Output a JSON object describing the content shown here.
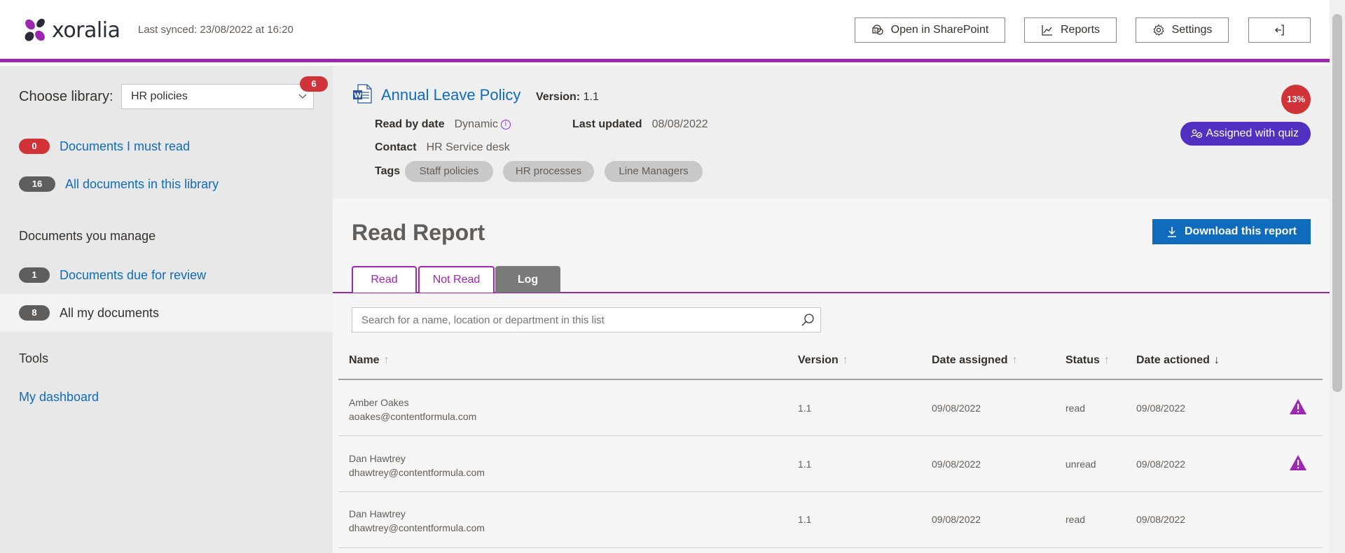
{
  "header": {
    "logo_text": "xoralia",
    "synced": "Last synced: 23/08/2022 at 16:20",
    "buttons": {
      "sharepoint": "Open in SharePoint",
      "reports": "Reports",
      "settings": "Settings"
    },
    "accent_color": "#9c27b0"
  },
  "sidebar": {
    "choose_label": "Choose library:",
    "library_value": "HR policies",
    "library_count": "6",
    "nav": [
      {
        "count": "0",
        "label": "Documents I must read"
      },
      {
        "count": "16",
        "label": "All documents in this library"
      }
    ],
    "manage_title": "Documents you manage",
    "manage": [
      {
        "count": "1",
        "label": "Documents due for review"
      },
      {
        "count": "8",
        "label": "All my documents"
      }
    ],
    "tools_title": "Tools",
    "tools_link": "My dashboard"
  },
  "document": {
    "title": "Annual Leave Policy",
    "version_label": "Version:",
    "version_value": "1.1",
    "read_by_label": "Read by date",
    "read_by_value": "Dynamic",
    "last_updated_label": "Last updated",
    "last_updated_value": "08/08/2022",
    "contact_label": "Contact",
    "contact_value": "HR Service desk",
    "tags_label": "Tags",
    "tags": [
      "Staff policies",
      "HR processes",
      "Line Managers"
    ],
    "percent": "13%",
    "quiz_badge": "Assigned with quiz"
  },
  "report": {
    "title": "Read Report",
    "download": "Download this report",
    "tabs": [
      "Read",
      "Not Read",
      "Log"
    ],
    "search_placeholder": "Search for a name, location or department in this list",
    "columns": [
      "Name",
      "Version",
      "Date assigned",
      "Status",
      "Date actioned"
    ],
    "rows": [
      {
        "name": "Amber Oakes",
        "email": "aoakes@contentformula.com",
        "version": "1.1",
        "assigned": "09/08/2022",
        "status": "read",
        "actioned": "09/08/2022",
        "warning": true
      },
      {
        "name": "Dan Hawtrey",
        "email": "dhawtrey@contentformula.com",
        "version": "1.1",
        "assigned": "09/08/2022",
        "status": "unread",
        "actioned": "09/08/2022",
        "warning": true
      },
      {
        "name": "Dan Hawtrey",
        "email": "dhawtrey@contentformula.com",
        "version": "1.1",
        "assigned": "09/08/2022",
        "status": "read",
        "actioned": "09/08/2022",
        "warning": false
      }
    ]
  }
}
